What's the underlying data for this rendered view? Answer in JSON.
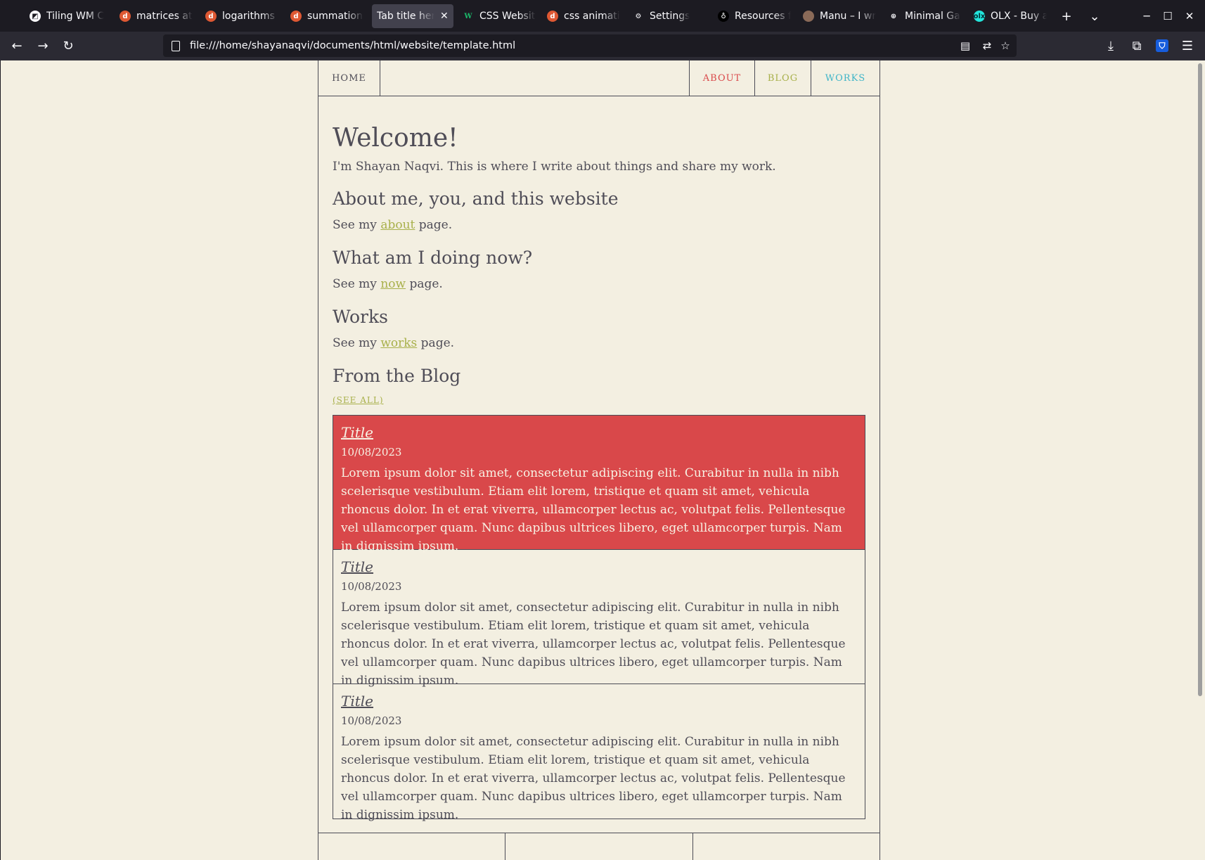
{
  "browser": {
    "tabs": [
      {
        "title": "Tiling WM C",
        "icon": "tiling-wm-icon"
      },
      {
        "title": "matrices at D",
        "icon": "duckduckgo-icon"
      },
      {
        "title": "logarithms a",
        "icon": "duckduckgo-icon"
      },
      {
        "title": "summation a",
        "icon": "duckduckgo-icon"
      },
      {
        "title": "Tab title here",
        "icon": "",
        "active": true
      },
      {
        "title": "CSS Website",
        "icon": "w-icon"
      },
      {
        "title": "css animation",
        "icon": "duckduckgo-icon"
      },
      {
        "title": "Settings",
        "icon": "gear-icon"
      },
      {
        "title": "Resources fo",
        "icon": "resources-icon"
      },
      {
        "title": "Manu – I wr",
        "icon": "avatar-icon"
      },
      {
        "title": "Minimal Gall",
        "icon": "globe-icon"
      },
      {
        "title": "OLX - Buy a",
        "icon": "olx-icon"
      }
    ],
    "new_tab_symbol": "+",
    "tab_list_symbol": "⌄",
    "close_tab_symbol": "✕",
    "window_buttons": {
      "minimize": "─",
      "maximize": "☐",
      "close": "✕"
    },
    "nav": {
      "back": "←",
      "forward": "→",
      "reload": "↻"
    },
    "url": "file:///home/shayanaqvi/documents/html/website/template.html",
    "toolbar_icons": [
      "reader-view-icon",
      "translate-icon",
      "bookmark-star-icon",
      "downloads-icon",
      "extensions-icon",
      "bitwarden-icon",
      "menu-icon"
    ]
  },
  "site": {
    "nav": {
      "home": "HOME",
      "about": "ABOUT",
      "blog": "BLOG",
      "works": "WORKS"
    },
    "colors": {
      "about": "#d9484a",
      "blog": "#a8b04a",
      "works": "#3fb5c8",
      "background": "#f3efe1",
      "text": "#4f4d57"
    },
    "welcome": {
      "heading": "Welcome!",
      "intro": "I'm Shayan Naqvi. This is where I write about things and share my work."
    },
    "sections": [
      {
        "heading": "About me, you, and this website",
        "prefix": "See my",
        "link": "about",
        "suffix": "page."
      },
      {
        "heading": "What am I doing now?",
        "prefix": "See my",
        "link": "now",
        "suffix": "page."
      },
      {
        "heading": "Works",
        "prefix": "See my",
        "link": "works",
        "suffix": "page."
      }
    ],
    "blog": {
      "heading": "From the Blog",
      "see_all": "(SEE ALL)",
      "posts": [
        {
          "title": "Title",
          "date": "10/08/2023",
          "body": "Lorem ipsum dolor sit amet, consectetur adipiscing elit. Curabitur in nulla in nibh scelerisque vestibulum. Etiam elit lorem, tristique et quam sit amet, vehicula rhoncus dolor. In et erat viverra, ullamcorper lectus ac, volutpat felis. Pellentesque vel ullamcorper quam. Nunc dapibus ultrices libero, eget ullamcorper turpis. Nam in dignissim ipsum.",
          "featured": true
        },
        {
          "title": "Title",
          "date": "10/08/2023",
          "body": "Lorem ipsum dolor sit amet, consectetur adipiscing elit. Curabitur in nulla in nibh scelerisque vestibulum. Etiam elit lorem, tristique et quam sit amet, vehicula rhoncus dolor. In et erat viverra, ullamcorper lectus ac, volutpat felis. Pellentesque vel ullamcorper quam. Nunc dapibus ultrices libero, eget ullamcorper turpis. Nam in dignissim ipsum.",
          "featured": false
        },
        {
          "title": "Title",
          "date": "10/08/2023",
          "body": "Lorem ipsum dolor sit amet, consectetur adipiscing elit. Curabitur in nulla in nibh scelerisque vestibulum. Etiam elit lorem, tristique et quam sit amet, vehicula rhoncus dolor. In et erat viverra, ullamcorper lectus ac, volutpat felis. Pellentesque vel ullamcorper quam. Nunc dapibus ultrices libero, eget ullamcorper turpis. Nam in dignissim ipsum.",
          "featured": false
        }
      ]
    }
  }
}
